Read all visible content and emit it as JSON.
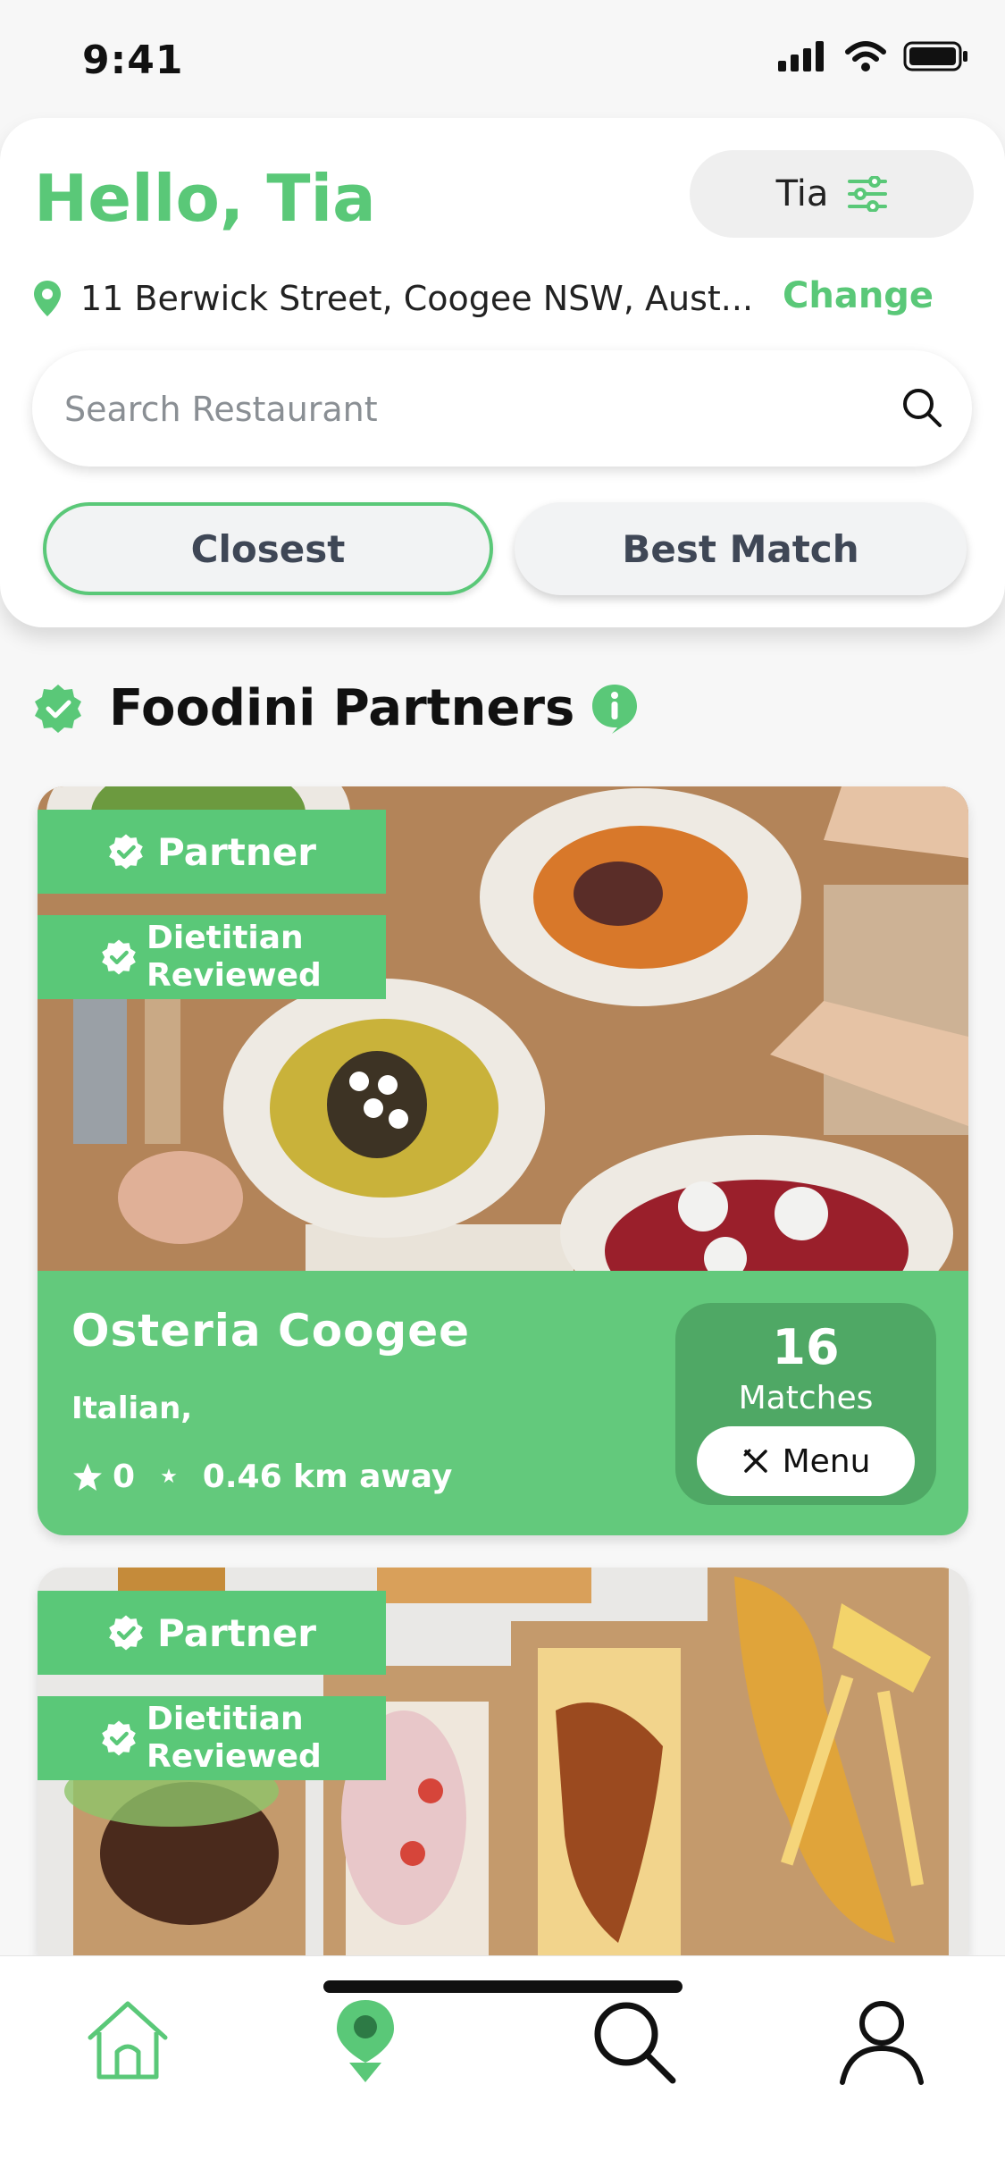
{
  "status_bar": {
    "time": "9:41"
  },
  "header": {
    "greeting": "Hello, Tia",
    "profile_name": "Tia",
    "address": "11 Berwick Street, Coogee NSW, Aust...",
    "change_label": "Change",
    "search_placeholder": "Search Restaurant",
    "sort_options": [
      {
        "label": "Closest",
        "selected": true
      },
      {
        "label": "Best Match",
        "selected": false
      }
    ]
  },
  "section": {
    "title": "Foodini Partners"
  },
  "badges": {
    "partner": "Partner",
    "dietitian_line1": "Dietitian",
    "dietitian_line2": "Reviewed"
  },
  "restaurants": [
    {
      "name": "Osteria Coogee",
      "cuisine": "Italian,",
      "rating": "0",
      "distance": "0.46 km away",
      "matches_count": "16",
      "matches_label": "Matches",
      "menu_label": "Menu"
    },
    {
      "name": "",
      "cuisine": ""
    }
  ],
  "tab_bar": {
    "items": [
      {
        "icon": "home-icon",
        "active": true
      },
      {
        "icon": "map-pin-icon",
        "active": true
      },
      {
        "icon": "search-icon",
        "active": false
      },
      {
        "icon": "profile-icon",
        "active": false
      }
    ]
  },
  "colors": {
    "accent": "#5ac878",
    "card_green": "#63c97c",
    "matches_green": "#4fa865",
    "text_dark": "#3f4756"
  }
}
